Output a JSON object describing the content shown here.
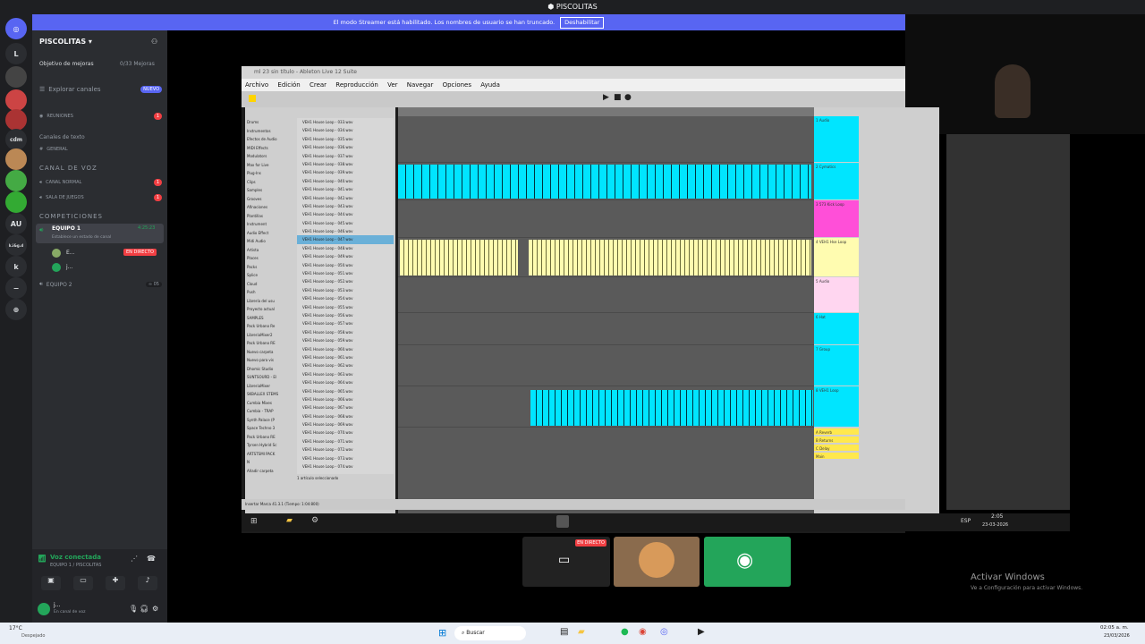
{
  "titlebar": {
    "title": "PISCOLITAS"
  },
  "streamer": {
    "text": "El modo Streamer está habilitado. Los nombres de usuario se han truncado.",
    "button": "Deshabilitar"
  },
  "rail": {
    "items": [
      "L",
      "cdm",
      "AU",
      "k.i&g.d",
      "k"
    ]
  },
  "sidebar": {
    "server_name": "PISCOLITAS",
    "boost": "Objetivo de mejoras",
    "boost_count": "0/33 Mejoras",
    "explore": "Explorar canales",
    "explore_badge": "NUEVO",
    "meetings": "REUNIONES",
    "meetings_badge": "1",
    "text_channels": "Canales de texto",
    "general": "GENERAL",
    "voice_header": "CANAL DE VOZ",
    "ch_normal": "CANAL NORMAL",
    "ch_normal_badge": "1",
    "ch_games": "SALA DE JUEGOS",
    "ch_games_badge": "1",
    "comp_header": "COMPETICIONES",
    "team1": "EQUIPO 1",
    "team1_time": "4:25:23",
    "team1_status": "Establece un estado de canal",
    "user1": "E...",
    "live": "EN DIRECTO",
    "user2": "j...",
    "team2": "EQUIPO 2",
    "team2_count": "05",
    "voice_connected": "Voz conectada",
    "voice_path": "EQUIPO 1 / PISCOLITAS",
    "user_name": "j...",
    "user_status": "En canal de voz"
  },
  "ableton": {
    "title": "ml 23 sin título - Ableton Live 12 Suite",
    "menu": [
      "Archivo",
      "Edición",
      "Crear",
      "Reproducción",
      "Ver",
      "Navegar",
      "Opciones",
      "Ayuda"
    ],
    "browser_items": [
      "Drums",
      "Instrumentos",
      "Efectos de Audio",
      "MIDI Effects",
      "Modulators",
      "Max for Live",
      "Plug-Ins",
      "Clips",
      "Samples",
      "Grooves",
      "Afinaciones",
      "Plantillas",
      "Instrument",
      "Audio Effect",
      "Midi Audio",
      "Artista",
      "Places",
      "Packs",
      "Splice",
      "Cloud",
      "Push",
      "Librería del usu",
      "Proyecto actual",
      "SAMPLES",
      "Pack Urbano Re",
      "LibreriaMixer2",
      "Pack Urbano RE",
      "Nuevo carpeta",
      "Nuevo para vis",
      "Dhomic Studio",
      "SUNTSOURD - El",
      "LibreriaMixer",
      "SKBALLEX STEMS",
      "Cumbia Mixes",
      "Cumbia - TRAP",
      "Synth Palace (P",
      "Space Techno 3",
      "Pack Urbano RE",
      "Tyrsen Hybrid Sc",
      "ARTSTSMI PACK",
      "N",
      "Añadir carpeta"
    ],
    "files": [
      "VEH1 House Loop - 033.wav",
      "VEH1 House Loop - 034.wav",
      "VEH1 House Loop - 035.wav",
      "VEH1 House Loop - 036.wav",
      "VEH1 House Loop - 037.wav",
      "VEH1 House Loop - 038.wav",
      "VEH1 House Loop - 039.wav",
      "VEH1 House Loop - 040.wav",
      "VEH1 House Loop - 041.wav",
      "VEH1 House Loop - 042.wav",
      "VEH1 House Loop - 043.wav",
      "VEH1 House Loop - 044.wav",
      "VEH1 House Loop - 045.wav",
      "VEH1 House Loop - 046.wav",
      "VEH1 House Loop - 047.wav",
      "VEH1 House Loop - 048.wav",
      "VEH1 House Loop - 049.wav",
      "VEH1 House Loop - 050.wav",
      "VEH1 House Loop - 051.wav",
      "VEH1 House Loop - 052.wav",
      "VEH1 House Loop - 053.wav",
      "VEH1 House Loop - 054.wav",
      "VEH1 House Loop - 055.wav",
      "VEH1 House Loop - 056.wav",
      "VEH1 House Loop - 057.wav",
      "VEH1 House Loop - 058.wav",
      "VEH1 House Loop - 059.wav",
      "VEH1 House Loop - 060.wav",
      "VEH1 House Loop - 061.wav",
      "VEH1 House Loop - 062.wav",
      "VEH1 House Loop - 063.wav",
      "VEH1 House Loop - 064.wav",
      "VEH1 House Loop - 065.wav",
      "VEH1 House Loop - 066.wav",
      "VEH1 House Loop - 067.wav",
      "VEH1 House Loop - 068.wav",
      "VEH1 House Loop - 069.wav",
      "VEH1 House Loop - 070.wav",
      "VEH1 House Loop - 071.wav",
      "VEH1 House Loop - 072.wav",
      "VEH1 House Loop - 073.wav",
      "VEH1 House Loop - 074.wav"
    ],
    "selected_info": "1 artículo seleccionado",
    "status": "Insertar Marca 41.3.1 (Tiempo: 1:04:800)",
    "track_names": [
      "1 Audio",
      "2 Cymatics",
      "3 573 Kick Loop",
      "4 VEH1 Hse Loop",
      "5 Audio",
      "6 Hat",
      "7 Group",
      "8 VEH1 Loop",
      "A Reverb",
      "B Returns",
      "C Delay",
      "Main"
    ],
    "clock": "2:05",
    "date": "23-03-2026",
    "lang": "ESP"
  },
  "thumbs": {
    "live": "EN DIRECTO"
  },
  "watermark": {
    "title": "Activar Windows",
    "sub": "Ve a Configuración para activar Windows."
  },
  "taskbar": {
    "weather_temp": "17°C",
    "weather": "Despejado",
    "search": "Buscar",
    "time": "02:05 a. m.",
    "date": "23/03/2026"
  },
  "colors": {
    "cyan": "#00e5ff",
    "yellow": "#fffcb0",
    "magenta": "#ff4fd8",
    "blurple": "#5865f2",
    "discord_green": "#23a55a"
  }
}
